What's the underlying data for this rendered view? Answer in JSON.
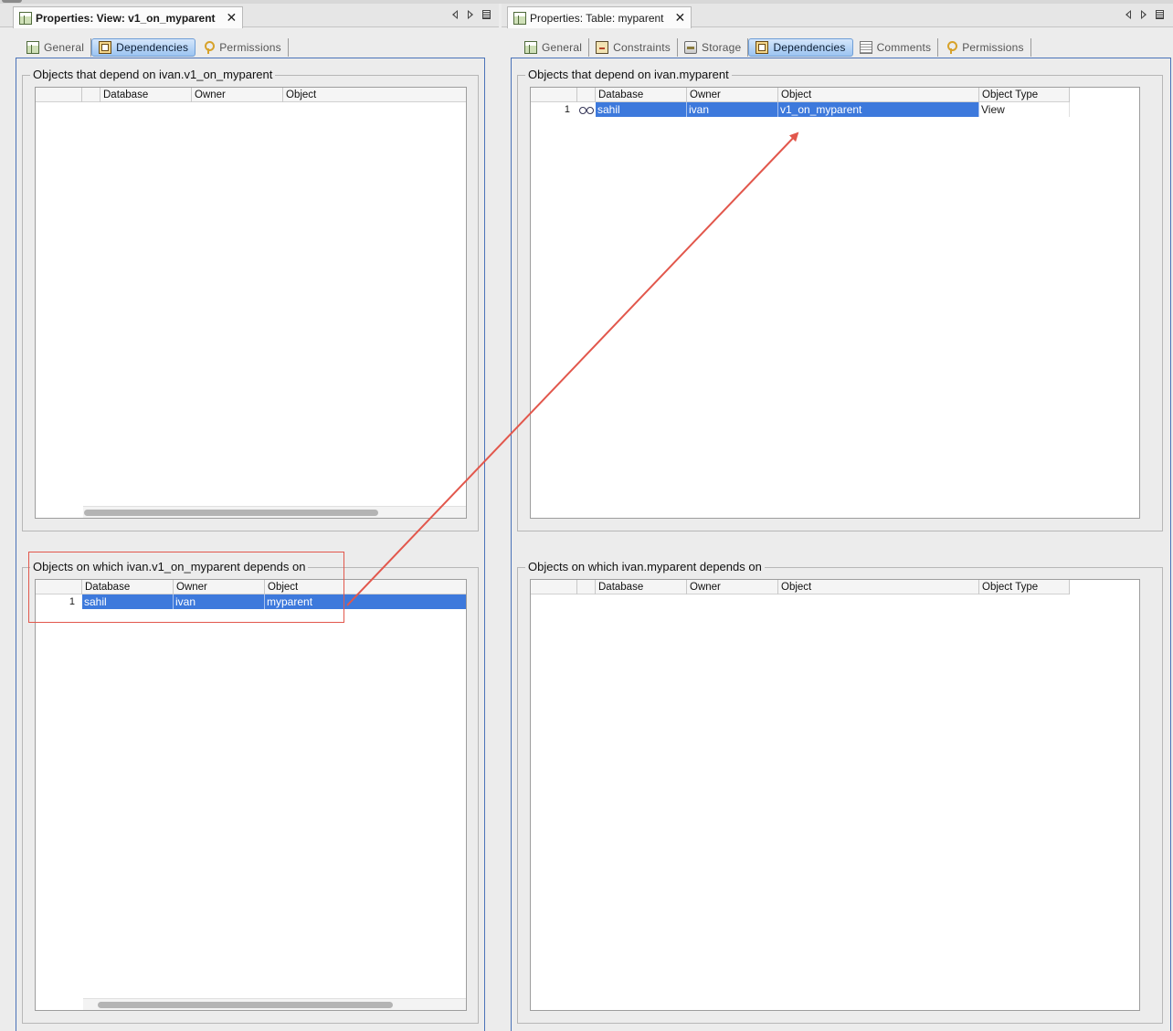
{
  "colors": {
    "selection": "#3d79dc",
    "annotation_red": "#e2574c",
    "panel_border": "#4a72b8"
  },
  "left": {
    "window_title": "Properties: View: v1_on_myparent",
    "tabs": [
      {
        "label": "General",
        "icon": "grid-icon"
      },
      {
        "label": "Dependencies",
        "icon": "dependencies-icon",
        "active": true
      },
      {
        "label": "Permissions",
        "icon": "key-icon"
      }
    ],
    "group1": {
      "title": "Objects that depend on ivan.v1_on_myparent",
      "columns": [
        "Database",
        "Owner",
        "Object"
      ],
      "rows": []
    },
    "group2": {
      "title": "Objects on which ivan.v1_on_myparent depends on",
      "columns": [
        "Database",
        "Owner",
        "Object"
      ],
      "rows": [
        {
          "num": "1",
          "database": "sahil",
          "owner": "ivan",
          "object": "myparent"
        }
      ]
    }
  },
  "right": {
    "window_title": "Properties: Table: myparent",
    "tabs": [
      {
        "label": "General",
        "icon": "grid-icon"
      },
      {
        "label": "Constraints",
        "icon": "constraints-icon"
      },
      {
        "label": "Storage",
        "icon": "storage-icon"
      },
      {
        "label": "Dependencies",
        "icon": "dependencies-icon",
        "active": true
      },
      {
        "label": "Comments",
        "icon": "comments-icon"
      },
      {
        "label": "Permissions",
        "icon": "key-icon"
      }
    ],
    "group1": {
      "title": "Objects that depend on ivan.myparent",
      "columns": [
        "Database",
        "Owner",
        "Object",
        "Object Type"
      ],
      "rows": [
        {
          "num": "1",
          "icon": "view-glasses-icon",
          "database": "sahil",
          "owner": "ivan",
          "object": "v1_on_myparent",
          "object_type": "View"
        }
      ]
    },
    "group2": {
      "title": "Objects on which ivan.myparent depends on",
      "columns": [
        "Database",
        "Owner",
        "Object",
        "Object Type"
      ],
      "rows": []
    }
  }
}
